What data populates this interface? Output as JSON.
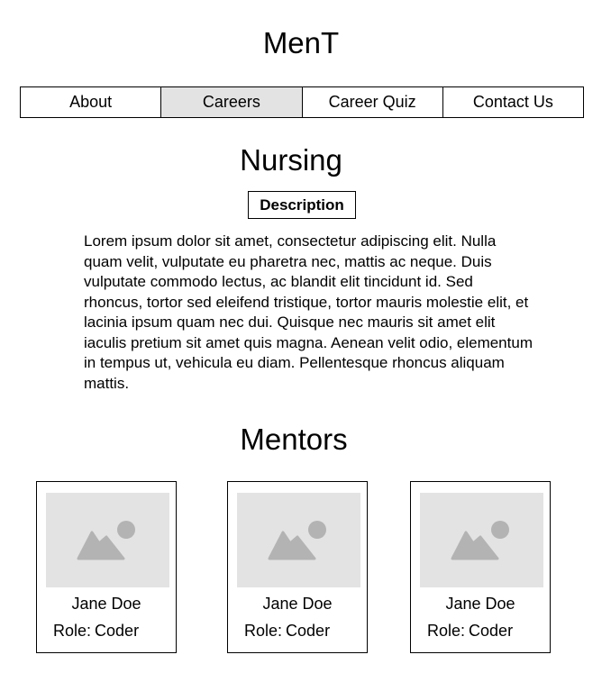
{
  "site": {
    "title": "MenT"
  },
  "nav": {
    "items": [
      {
        "label": "About"
      },
      {
        "label": "Careers",
        "active": true
      },
      {
        "label": "Career Quiz"
      },
      {
        "label": "Contact Us"
      }
    ]
  },
  "career": {
    "title": "Nursing",
    "description_tag": "Description",
    "description": "Lorem ipsum dolor sit amet, consectetur adipiscing elit. Nulla quam velit, vulputate eu pharetra nec, mattis ac neque. Duis vulputate commodo lectus, ac blandit elit tincidunt id. Sed rhoncus, tortor sed eleifend tristique, tortor mauris molestie elit, et lacinia ipsum quam nec dui. Quisque nec mauris sit amet elit iaculis pretium sit amet quis magna. Aenean velit odio, elementum in tempus ut, vehicula eu diam. Pellentesque rhoncus aliquam mattis."
  },
  "mentors": {
    "title": "Mentors",
    "items": [
      {
        "name": "Jane Doe",
        "role_label": "Role:",
        "role": "Coder",
        "image_icon": "image-placeholder-icon"
      },
      {
        "name": "Jane Doe",
        "role_label": "Role:",
        "role": "Coder",
        "image_icon": "image-placeholder-icon"
      },
      {
        "name": "Jane Doe",
        "role_label": "Role:",
        "role": "Coder",
        "image_icon": "image-placeholder-icon"
      }
    ]
  },
  "colors": {
    "active_tab_bg": "#e3e3e3",
    "placeholder_bg": "#e3e3e3",
    "placeholder_glyph": "#b3b3b3",
    "border": "#000000"
  }
}
